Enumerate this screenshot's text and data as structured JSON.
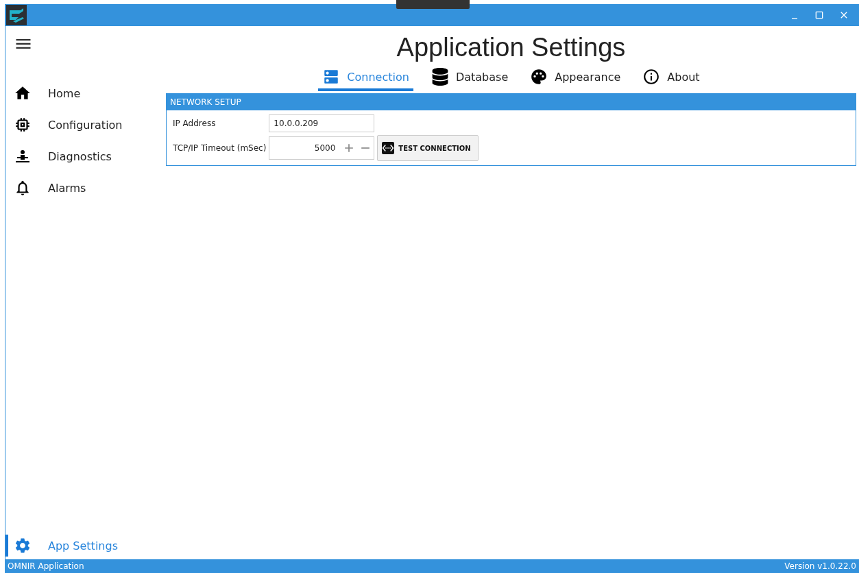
{
  "sidebar": {
    "items": [
      {
        "label": "Home",
        "selected": false
      },
      {
        "label": "Configuration",
        "selected": false
      },
      {
        "label": "Diagnostics",
        "selected": false
      },
      {
        "label": "Alarms",
        "selected": false
      }
    ],
    "footer_item": {
      "label": "App Settings",
      "selected": true
    }
  },
  "page_title": "Application Settings",
  "tabs": [
    {
      "label": "Connection",
      "selected": true
    },
    {
      "label": "Database",
      "selected": false
    },
    {
      "label": "Appearance",
      "selected": false
    },
    {
      "label": "About",
      "selected": false
    }
  ],
  "network_setup": {
    "header": "NETWORK SETUP",
    "ip_label": "IP Address",
    "ip_value": "10.0.0.209",
    "timeout_label": "TCP/IP Timeout (mSec)",
    "timeout_value": "5000",
    "test_button": "TEST CONNECTION"
  },
  "status_bar": {
    "left": "OMNIR Application",
    "right": "Version v1.0.22.0"
  }
}
